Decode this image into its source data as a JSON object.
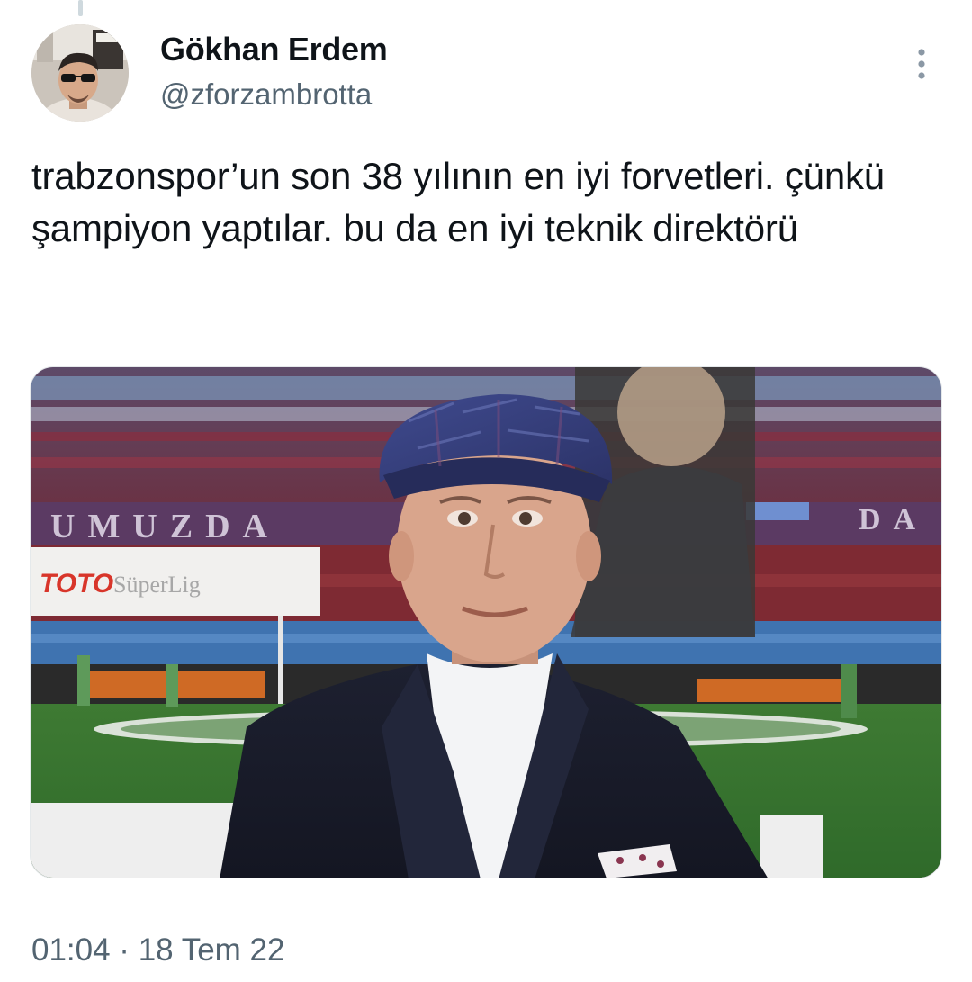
{
  "tweet": {
    "author": {
      "display_name": "Gökhan Erdem",
      "handle": "@zforzambrotta"
    },
    "text": "trabzonspor’un son 38 yılının en iyi forvetleri. çünkü şampiyon yaptılar. bu da en iyi teknik direktörü",
    "timestamp": "01:04 · 18 Tem 22"
  },
  "media": {
    "banner_text": "UMUZDA",
    "banner_text_right": "DA",
    "board_text_red": "TOTO",
    "board_text_grey": "SüperLig"
  },
  "icons": {
    "more": "more-vertical-icon"
  },
  "colors": {
    "text_primary": "#0f1419",
    "text_secondary": "#536471",
    "thread_line": "#cfd9de"
  }
}
